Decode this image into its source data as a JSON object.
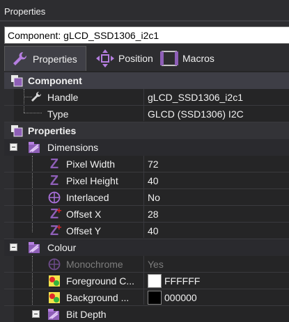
{
  "panel": {
    "title": "Properties"
  },
  "component": {
    "label": "Component: gLCD_SSD1306_i2c1"
  },
  "tabs": [
    {
      "label": "Properties",
      "active": true
    },
    {
      "label": "Position",
      "active": false
    },
    {
      "label": "Macros",
      "active": false
    }
  ],
  "grid": {
    "component_section": {
      "label": "Component",
      "rows": [
        {
          "name": "Handle",
          "value": "gLCD_SSD1306_i2c1",
          "icon": "wrench-icon"
        },
        {
          "name": "Type",
          "value": "GLCD (SSD1306) I2C"
        }
      ]
    },
    "properties_section": {
      "label": "Properties",
      "dimensions": {
        "label": "Dimensions",
        "rows": [
          {
            "name": "Pixel Width",
            "value": "72",
            "icon": "z-icon"
          },
          {
            "name": "Pixel Height",
            "value": "40",
            "icon": "z-icon"
          },
          {
            "name": "Interlaced",
            "value": "No",
            "icon": "toggle-icon"
          },
          {
            "name": "Offset X",
            "value": "28",
            "icon": "z-plus-icon"
          },
          {
            "name": "Offset Y",
            "value": "40",
            "icon": "z-plus-icon"
          }
        ]
      },
      "colour": {
        "label": "Colour",
        "rows": [
          {
            "name": "Monochrome",
            "value": "Yes",
            "icon": "toggle-icon",
            "disabled": true
          },
          {
            "name": "Foreground C...",
            "value": "FFFFFF",
            "icon": "colour-icon",
            "swatch": "#ffffff"
          },
          {
            "name": "Background ...",
            "value": "000000",
            "icon": "colour-icon",
            "swatch": "#000000"
          }
        ]
      },
      "bit_depth": {
        "label": "Bit Depth"
      }
    }
  },
  "colors": {
    "accent_purple": "#8e5fb7",
    "z_red": "#d9262b",
    "selected_row": "#3e3e46"
  }
}
